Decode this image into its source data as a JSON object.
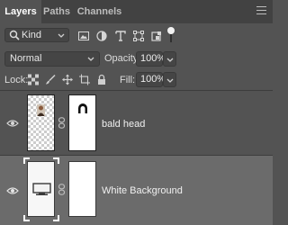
{
  "tabs": [
    {
      "label": "Layers",
      "active": true
    },
    {
      "label": "Paths",
      "active": false
    },
    {
      "label": "Channels",
      "active": false
    }
  ],
  "filter": {
    "kind_label": "Kind",
    "filter_icons": [
      "image-filter-icon",
      "adjustment-filter-icon",
      "type-filter-icon",
      "shape-filter-icon",
      "smart-object-filter-icon",
      "filter-toggle"
    ]
  },
  "blend": {
    "mode": "Normal",
    "opacity_label": "Opacity:",
    "opacity_value": "100%"
  },
  "lock": {
    "label": "Lock:",
    "fill_label": "Fill:",
    "fill_value": "100%"
  },
  "layers": [
    {
      "name": "bald head",
      "visible": true,
      "selected": false
    },
    {
      "name": "White Background",
      "visible": true,
      "selected": true
    }
  ],
  "colors": {
    "panel_bg": "#535353",
    "tabbar_bg": "#424242",
    "selected_layer_bg": "#6b6b6b"
  }
}
